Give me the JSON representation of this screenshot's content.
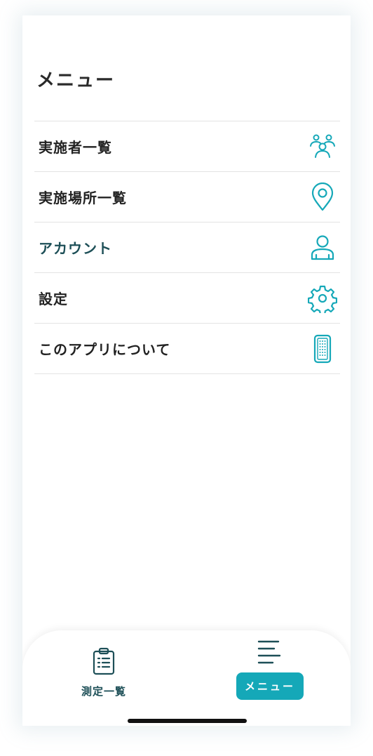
{
  "page": {
    "title": "メニュー"
  },
  "menu": {
    "items": [
      {
        "label": "実施者一覧",
        "icon": "people-icon"
      },
      {
        "label": "実施場所一覧",
        "icon": "location-pin-icon"
      },
      {
        "label": "アカウント",
        "icon": "account-icon"
      },
      {
        "label": "設定",
        "icon": "gear-icon"
      },
      {
        "label": "このアプリについて",
        "icon": "smartphone-icon"
      }
    ]
  },
  "tabbar": {
    "tabs": [
      {
        "label": "測定一覧",
        "icon": "clipboard-icon",
        "active": false
      },
      {
        "label": "メニュー",
        "icon": "menu-lines-icon",
        "active": true
      }
    ]
  },
  "colors": {
    "accent": "#15a8b8",
    "dark_teal": "#1d4f57",
    "text": "#222222",
    "divider": "#e3e3e3"
  }
}
